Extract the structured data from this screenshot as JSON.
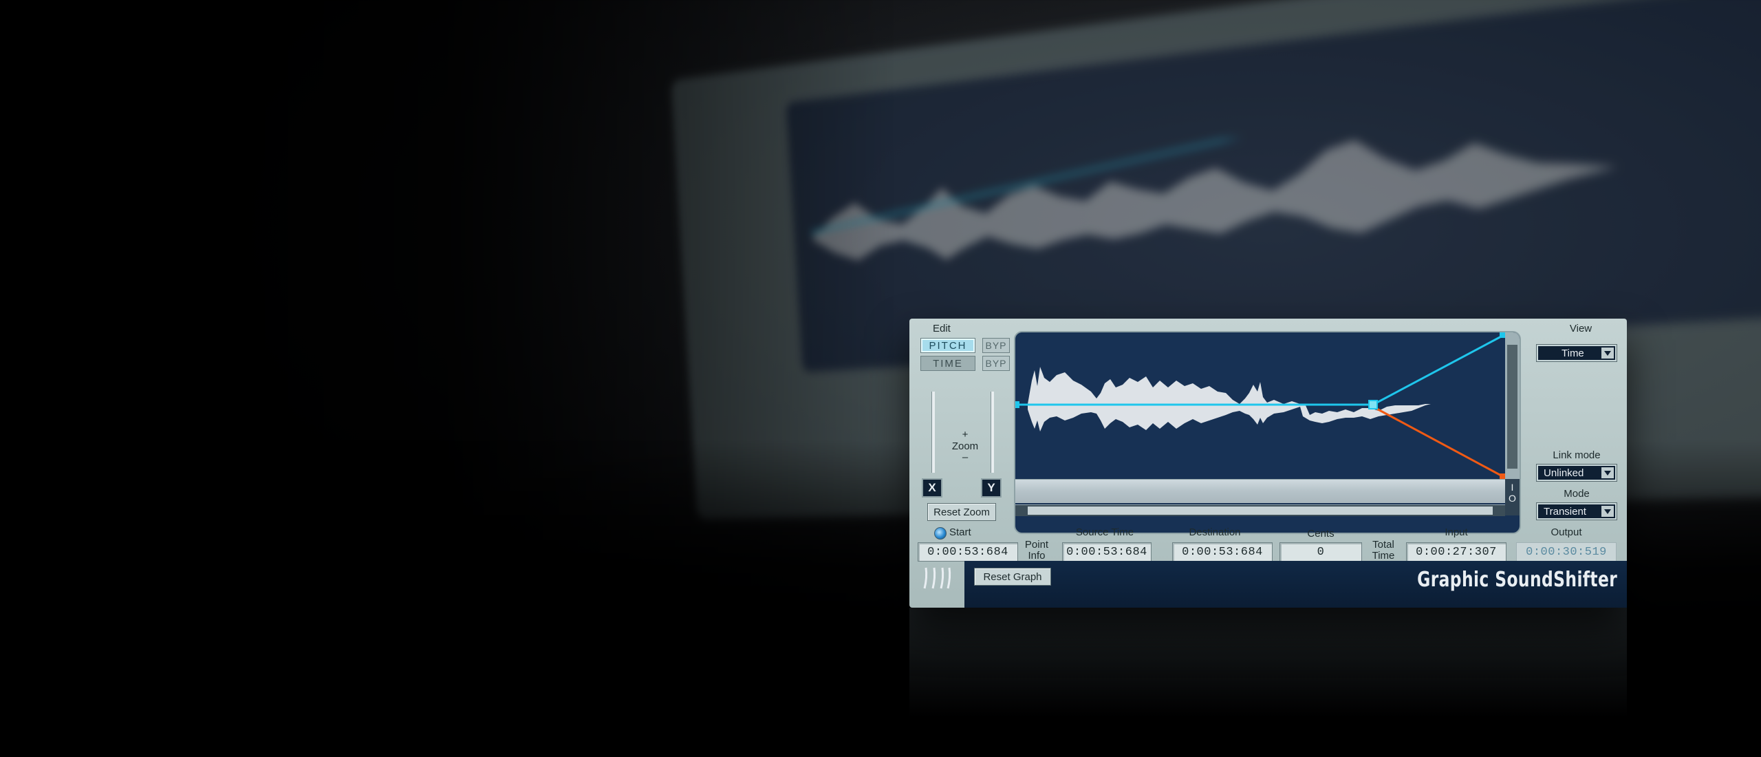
{
  "edit": {
    "label": "Edit",
    "pitch_label": "PITCH",
    "time_label": "TIME",
    "bypass_label": "BYP",
    "zoom_plus": "+",
    "zoom_label": "Zoom",
    "zoom_minus": "–",
    "x_label": "X",
    "y_label": "Y",
    "reset_zoom_label": "Reset Zoom"
  },
  "right_panel": {
    "view_label": "View",
    "view_value": "Time",
    "link_mode_label": "Link mode",
    "link_mode_value": "Unlinked",
    "mode_label": "Mode",
    "mode_value": "Transient"
  },
  "graph": {
    "io_top": "I",
    "io_bottom": "O"
  },
  "info": {
    "start_label": "Start",
    "start_value": "0:00:53:684",
    "point_info_label_1": "Point",
    "point_info_label_2": "Info",
    "source_time_label": "Source Time",
    "source_time_value": "0:00:53:684",
    "destination_label": "Destination",
    "destination_value": "0:00:53:684",
    "cents_label": "Cents",
    "cents_value": "0",
    "total_time_label_1": "Total",
    "total_time_label_2": "Time",
    "input_label": "Input",
    "input_value": "0:00:27:307",
    "output_label": "Output",
    "output_value": "0:00:30:519"
  },
  "footer": {
    "reset_graph_label": "Reset Graph",
    "brand": "Graphic SoundShifter"
  },
  "colors": {
    "pitch_line": "#1fc6ec",
    "time_line": "#f05a14",
    "graph_bg": "#173154",
    "panel": "#b4c5c5"
  },
  "icons": {
    "logo": "waves-logo-icon",
    "radio": "radio-selected-icon"
  }
}
